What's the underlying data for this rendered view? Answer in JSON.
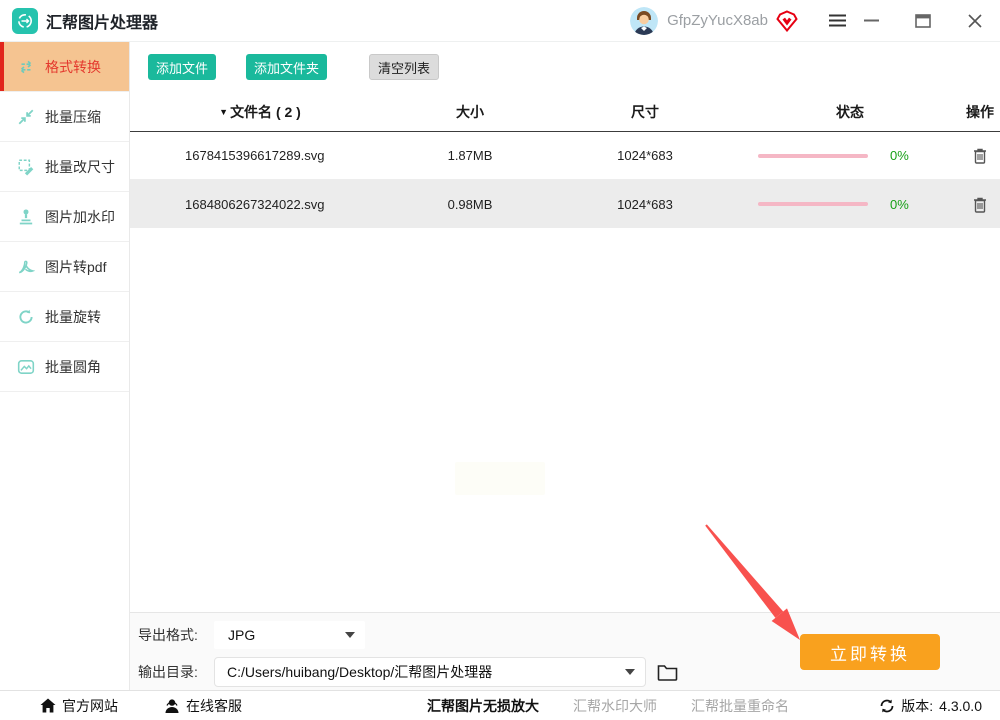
{
  "window": {
    "title": "汇帮图片处理器",
    "username": "GfpZyYucX8ab"
  },
  "sidebar": {
    "items": [
      {
        "label": "格式转换",
        "active": true
      },
      {
        "label": "批量压缩",
        "active": false
      },
      {
        "label": "批量改尺寸",
        "active": false
      },
      {
        "label": "图片加水印",
        "active": false
      },
      {
        "label": "图片转pdf",
        "active": false
      },
      {
        "label": "批量旋转",
        "active": false
      },
      {
        "label": "批量圆角",
        "active": false
      }
    ]
  },
  "toolbar": {
    "add_file": "添加文件",
    "add_folder": "添加文件夹",
    "clear_list": "清空列表"
  },
  "table": {
    "headers": {
      "name": "文件名 ( 2 )",
      "size": "大小",
      "dims": "尺寸",
      "status": "状态",
      "action": "操作"
    },
    "rows": [
      {
        "name": "1678415396617289.svg",
        "size": "1.87MB",
        "dims": "1024*683",
        "progress_pct": "0%"
      },
      {
        "name": "1684806267324022.svg",
        "size": "0.98MB",
        "dims": "1024*683",
        "progress_pct": "0%"
      }
    ]
  },
  "output": {
    "format_label": "导出格式:",
    "format_value": "JPG",
    "dir_label": "输出目录:",
    "dir_value": "C:/Users/huibang/Desktop/汇帮图片处理器",
    "convert_button": "立即转换"
  },
  "statusbar": {
    "official_site": "官方网站",
    "online_support": "在线客服",
    "link_upscale": "汇帮图片无损放大",
    "link_watermark": "汇帮水印大师",
    "link_rename": "汇帮批量重命名",
    "version_label": "版本:",
    "version_value": "4.3.0.0"
  },
  "icons": {
    "sort_caret": "▼"
  },
  "colors": {
    "accent_teal": "#1ab99c",
    "active_bg": "#f5c491",
    "active_red": "#e4392e",
    "convert_orange": "#f9a11e",
    "progress_pink": "#f5b7c5",
    "percent_green": "#18a018",
    "annotation_red": "#f8514e"
  }
}
